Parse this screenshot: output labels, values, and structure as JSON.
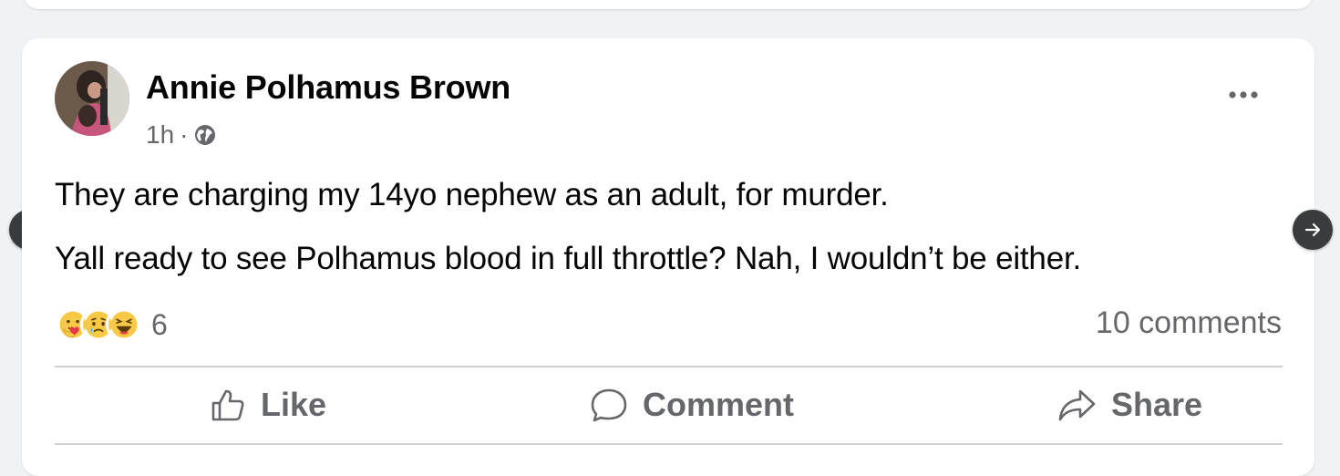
{
  "post": {
    "author": "Annie Polhamus Brown",
    "time": "1h",
    "separator": "·",
    "audience_icon": "globe-icon",
    "text_lines": [
      "They are charging my 14yo nephew as an adult, for murder.",
      "Yall ready to see Polhamus blood in full throttle? Nah, I wouldn’t be either."
    ],
    "reactions": {
      "icons": [
        "care-reaction-icon",
        "sad-reaction-icon",
        "haha-reaction-icon"
      ],
      "count": "6"
    },
    "comments_count": "10 comments"
  },
  "actions": {
    "like": "Like",
    "comment": "Comment",
    "share": "Share"
  },
  "colors": {
    "background": "#f0f2f5",
    "card": "#ffffff",
    "secondary_text": "#65676b",
    "primary_text": "#050505",
    "arrow_button": "#3a3b3c"
  }
}
